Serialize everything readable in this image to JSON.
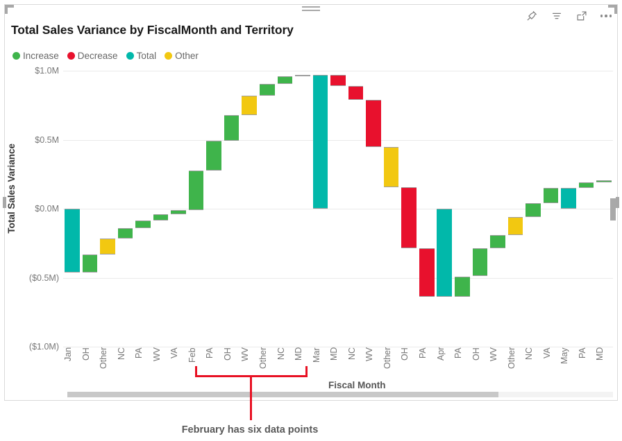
{
  "header": {
    "title": "Total Sales Variance by FiscalMonth and Territory",
    "toolbar": [
      {
        "name": "pin-icon",
        "label": "Pin to dashboard"
      },
      {
        "name": "filter-icon",
        "label": "Filters"
      },
      {
        "name": "focus-mode-icon",
        "label": "Focus mode"
      },
      {
        "name": "more-options-icon",
        "label": "More options"
      }
    ]
  },
  "legend": [
    {
      "label": "Increase",
      "color": "#3FB44B"
    },
    {
      "label": "Decrease",
      "color": "#E8112D"
    },
    {
      "label": "Total",
      "color": "#01B8AA"
    },
    {
      "label": "Other",
      "color": "#F2C811"
    }
  ],
  "annotation": {
    "caption": "February has six data points",
    "color": "#E81123",
    "covers": [
      "Feb",
      "PA",
      "OH",
      "WV",
      "Other",
      "NC",
      "MD"
    ]
  },
  "scrollbars": {
    "horizontal_thumb_percent": 79,
    "vertical_thumb_percent": 8
  },
  "chart_data": {
    "type": "bar",
    "subtype": "waterfall",
    "title": "Total Sales Variance by FiscalMonth and Territory",
    "xlabel": "Fiscal Month",
    "ylabel": "Total Sales Variance",
    "ylim": [
      -1000000,
      1000000
    ],
    "ytick_values": [
      1000000,
      500000,
      0,
      -500000,
      -1000000
    ],
    "ytick_labels": [
      "$1.0M",
      "$0.5M",
      "$0.0M",
      "($0.5M)",
      "($1.0M)"
    ],
    "grid": true,
    "legend_position": "top-left",
    "categories": [
      "Jan",
      "OH",
      "Other",
      "NC",
      "PA",
      "WV",
      "VA",
      "Feb",
      "PA",
      "OH",
      "WV",
      "Other",
      "NC",
      "MD",
      "Mar",
      "MD",
      "NC",
      "WV",
      "Other",
      "OH",
      "PA",
      "Apr",
      "PA",
      "OH",
      "WV",
      "Other",
      "NC",
      "VA",
      "May",
      "PA",
      "MD"
    ],
    "bars": [
      {
        "category": "Jan",
        "kind": "Total",
        "color": "#01B8AA",
        "start": 0,
        "end": -460000,
        "value": -460000
      },
      {
        "category": "OH",
        "kind": "Increase",
        "color": "#3FB44B",
        "start": -460000,
        "end": -330000,
        "value": 130000
      },
      {
        "category": "Other",
        "kind": "Other",
        "color": "#F2C811",
        "start": -330000,
        "end": -215000,
        "value": 115000
      },
      {
        "category": "NC",
        "kind": "Increase",
        "color": "#3FB44B",
        "start": -215000,
        "end": -140000,
        "value": 75000
      },
      {
        "category": "PA",
        "kind": "Increase",
        "color": "#3FB44B",
        "start": -140000,
        "end": -85000,
        "value": 55000
      },
      {
        "category": "WV",
        "kind": "Increase",
        "color": "#3FB44B",
        "start": -85000,
        "end": -40000,
        "value": 45000
      },
      {
        "category": "VA",
        "kind": "Increase",
        "color": "#3FB44B",
        "start": -40000,
        "end": -10000,
        "value": 30000
      },
      {
        "category": "Feb",
        "kind": "Increase",
        "color": "#3FB44B",
        "start": -10000,
        "end": 275000,
        "value": 285000
      },
      {
        "category": "PA",
        "kind": "Increase",
        "color": "#3FB44B",
        "start": 275000,
        "end": 490000,
        "value": 215000
      },
      {
        "category": "OH",
        "kind": "Increase",
        "color": "#3FB44B",
        "start": 490000,
        "end": 680000,
        "value": 190000
      },
      {
        "category": "WV",
        "kind": "Other",
        "color": "#F2C811",
        "start": 680000,
        "end": 820000,
        "value": 140000
      },
      {
        "category": "Other",
        "kind": "Increase",
        "color": "#3FB44B",
        "start": 820000,
        "end": 905000,
        "value": 85000
      },
      {
        "category": "NC",
        "kind": "Increase",
        "color": "#3FB44B",
        "start": 905000,
        "end": 960000,
        "value": 55000
      },
      {
        "category": "MD",
        "kind": "Increase",
        "color": "#3FB44B",
        "start": 960000,
        "end": 970000,
        "value": 10000
      },
      {
        "category": "Mar",
        "kind": "Total",
        "color": "#01B8AA",
        "start": 0,
        "end": 970000,
        "value": 970000
      },
      {
        "category": "MD",
        "kind": "Decrease",
        "color": "#E8112D",
        "start": 970000,
        "end": 890000,
        "value": -80000
      },
      {
        "category": "NC",
        "kind": "Decrease",
        "color": "#E8112D",
        "start": 890000,
        "end": 790000,
        "value": -100000
      },
      {
        "category": "WV",
        "kind": "Decrease",
        "color": "#E8112D",
        "start": 790000,
        "end": 445000,
        "value": -345000
      },
      {
        "category": "Other",
        "kind": "Other",
        "color": "#F2C811",
        "start": 445000,
        "end": 155000,
        "value": -290000
      },
      {
        "category": "OH",
        "kind": "Decrease",
        "color": "#E8112D",
        "start": 155000,
        "end": -285000,
        "value": -440000
      },
      {
        "category": "PA",
        "kind": "Decrease",
        "color": "#E8112D",
        "start": -285000,
        "end": -640000,
        "value": -355000
      },
      {
        "category": "Apr",
        "kind": "Total",
        "color": "#01B8AA",
        "start": 0,
        "end": -640000,
        "value": -640000
      },
      {
        "category": "PA",
        "kind": "Increase",
        "color": "#3FB44B",
        "start": -640000,
        "end": -490000,
        "value": 150000
      },
      {
        "category": "OH",
        "kind": "Increase",
        "color": "#3FB44B",
        "start": -490000,
        "end": -285000,
        "value": 205000
      },
      {
        "category": "WV",
        "kind": "Increase",
        "color": "#3FB44B",
        "start": -285000,
        "end": -190000,
        "value": 95000
      },
      {
        "category": "Other",
        "kind": "Other",
        "color": "#F2C811",
        "start": -190000,
        "end": -60000,
        "value": 130000
      },
      {
        "category": "NC",
        "kind": "Increase",
        "color": "#3FB44B",
        "start": -60000,
        "end": 40000,
        "value": 100000
      },
      {
        "category": "VA",
        "kind": "Increase",
        "color": "#3FB44B",
        "start": 40000,
        "end": 150000,
        "value": 110000
      },
      {
        "category": "May",
        "kind": "Total",
        "color": "#01B8AA",
        "start": 0,
        "end": 150000,
        "value": 150000
      },
      {
        "category": "PA",
        "kind": "Increase",
        "color": "#3FB44B",
        "start": 150000,
        "end": 190000,
        "value": 40000
      },
      {
        "category": "MD",
        "kind": "Increase",
        "color": "#3FB44B",
        "start": 190000,
        "end": 205000,
        "value": 15000
      }
    ]
  }
}
